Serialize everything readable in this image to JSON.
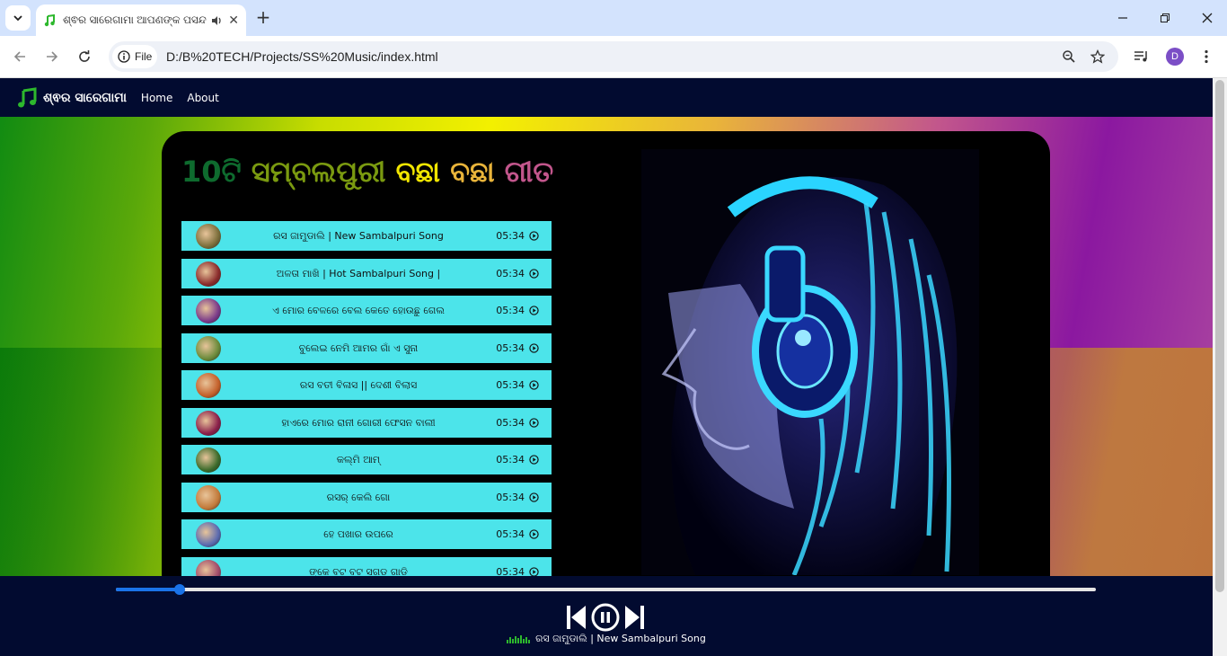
{
  "browser": {
    "tab_title": "ଶ୍ଵର ସାରେଗାମା ଆପଣଙ୍କ ପସନ୍ଦ",
    "chip_label": "File",
    "url": "D:/B%20TECH/Projects/SS%20Music/index.html",
    "profile_initial": "D"
  },
  "site": {
    "brand": "ଶ୍ଵର ସାରେଗାମା",
    "nav": [
      "Home",
      "About"
    ],
    "headline_parts": [
      {
        "text": "10ଟି ",
        "color": "#0e6b2e"
      },
      {
        "text": "ସମ୍ବଲପୁରୀ ",
        "color": "#7a9a10"
      },
      {
        "text": "ବଛା ",
        "color": "#f1e600"
      },
      {
        "text": "ବଛା ",
        "color": "#e9b43a"
      },
      {
        "text": "ଗୀତ",
        "color": "#c2568c"
      }
    ]
  },
  "songs": [
    {
      "title": "ରସ ଜାମୁଡାଲି | New Sambalpuri Song",
      "duration": "05:34",
      "thumb": "#7a6d3a"
    },
    {
      "title": "ଅଳତା ମାଖି | Hot Sambalpuri Song |",
      "duration": "05:34",
      "thumb": "#8a2b2b"
    },
    {
      "title": "ଏ ମୋର ବେଳରେ ବେଲ କେତେ ହୋଉଛୁ ଗେଲ",
      "duration": "05:34",
      "thumb": "#7a3a8a"
    },
    {
      "title": "ବୁଲେଇ ନେମି ଆମର ଗାଁ ଏ ସୁନା",
      "duration": "05:34",
      "thumb": "#6a8a3a"
    },
    {
      "title": "ରସ ବତୀ ବିଳାସ || ଦେଶୀ ବିଲାସ",
      "duration": "05:34",
      "thumb": "#c4602a"
    },
    {
      "title": "ହାଏରେ ମୋର ରାନୀ ଗୋରୀ ଫେସନ ବାଲୀ",
      "duration": "05:34",
      "thumb": "#8a1f4a"
    },
    {
      "title": "କଲ୍ମି ଆମ୍",
      "duration": "05:34",
      "thumb": "#3a6a2a"
    },
    {
      "title": "ରସର୍ କେଲି ଗୋ",
      "duration": "05:34",
      "thumb": "#c27a3a"
    },
    {
      "title": "ହେ ପଖାର ଉପରେ",
      "duration": "05:34",
      "thumb": "#5a6ab0"
    },
    {
      "title": "ଙ୍କେ ବଟ ବଟ ସଗଡ ଗାଡି",
      "duration": "05:34",
      "thumb": "#a04a6a"
    }
  ],
  "player": {
    "now_playing": "ରସ ଜାମୁଡାଲି | New Sambalpuri Song",
    "progress": 0.065
  },
  "colors": {
    "accent": "#1a73e8",
    "navbar": "#020b30",
    "song_row": "#4ce4ea"
  }
}
